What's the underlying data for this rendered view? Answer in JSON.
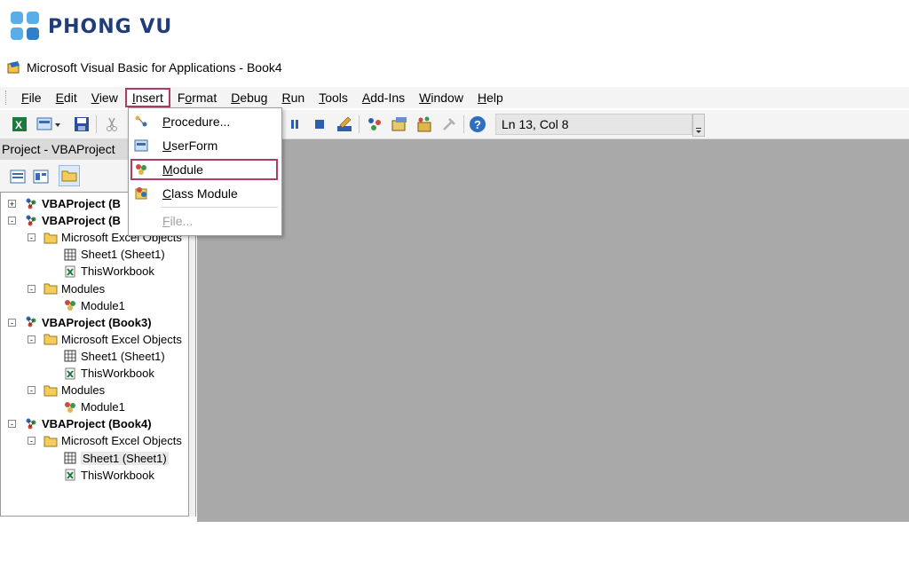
{
  "logo": {
    "text": "PHONG VU",
    "color": "#1f3d7a",
    "accent": "#5aaee8"
  },
  "window": {
    "title": "Microsoft Visual Basic for Applications - Book4",
    "icon": "vba-app-icon"
  },
  "menubar": {
    "items": [
      {
        "id": "file",
        "label": "File",
        "mnemonic": "F"
      },
      {
        "id": "edit",
        "label": "Edit",
        "mnemonic": "E"
      },
      {
        "id": "view",
        "label": "View",
        "mnemonic": "V"
      },
      {
        "id": "insert",
        "label": "Insert",
        "mnemonic": "I",
        "active": true
      },
      {
        "id": "format",
        "label": "Format",
        "mnemonic": "o"
      },
      {
        "id": "debug",
        "label": "Debug",
        "mnemonic": "D"
      },
      {
        "id": "run",
        "label": "Run",
        "mnemonic": "R"
      },
      {
        "id": "tools",
        "label": "Tools",
        "mnemonic": "T"
      },
      {
        "id": "addins",
        "label": "Add-Ins",
        "mnemonic": "A"
      },
      {
        "id": "window",
        "label": "Window",
        "mnemonic": "W"
      },
      {
        "id": "help",
        "label": "Help",
        "mnemonic": "H"
      }
    ]
  },
  "toolbar": {
    "position_text": "Ln 13, Col 8"
  },
  "insert_menu": {
    "items": [
      {
        "label": "Procedure...",
        "icon": "procedure-icon",
        "enabled": true
      },
      {
        "label": "UserForm",
        "icon": "userform-icon",
        "enabled": true
      },
      {
        "label": "Module",
        "icon": "module-icon",
        "enabled": true,
        "highlighted": true
      },
      {
        "label": "Class Module",
        "icon": "class-module-icon",
        "enabled": true
      },
      {
        "label": "File...",
        "icon": "",
        "enabled": false
      }
    ]
  },
  "project": {
    "title": "Project - VBAProject",
    "tree": [
      {
        "label": "VBAProject (B",
        "level": 0,
        "bold": true,
        "icon": "vbaproject-icon",
        "expander": "+"
      },
      {
        "label": "VBAProject (B",
        "level": 0,
        "bold": true,
        "icon": "vbaproject-icon",
        "expander": "-"
      },
      {
        "label": "Microsoft Excel Objects",
        "level": 1,
        "icon": "folder-icon",
        "expander": "-"
      },
      {
        "label": "Sheet1 (Sheet1)",
        "level": 2,
        "icon": "sheet-icon"
      },
      {
        "label": "ThisWorkbook",
        "level": 2,
        "icon": "workbook-icon"
      },
      {
        "label": "Modules",
        "level": 1,
        "icon": "folder-icon",
        "expander": "-"
      },
      {
        "label": "Module1",
        "level": 2,
        "icon": "module-icon"
      },
      {
        "label": "VBAProject (Book3)",
        "level": 0,
        "bold": true,
        "icon": "vbaproject-icon",
        "expander": "-"
      },
      {
        "label": "Microsoft Excel Objects",
        "level": 1,
        "icon": "folder-icon",
        "expander": "-"
      },
      {
        "label": "Sheet1 (Sheet1)",
        "level": 2,
        "icon": "sheet-icon"
      },
      {
        "label": "ThisWorkbook",
        "level": 2,
        "icon": "workbook-icon"
      },
      {
        "label": "Modules",
        "level": 1,
        "icon": "folder-icon",
        "expander": "-"
      },
      {
        "label": "Module1",
        "level": 2,
        "icon": "module-icon"
      },
      {
        "label": "VBAProject (Book4)",
        "level": 0,
        "bold": true,
        "icon": "vbaproject-icon",
        "expander": "-"
      },
      {
        "label": "Microsoft Excel Objects",
        "level": 1,
        "icon": "folder-icon",
        "expander": "-"
      },
      {
        "label": "Sheet1 (Sheet1)",
        "level": 2,
        "icon": "sheet-icon",
        "selected": true
      },
      {
        "label": "ThisWorkbook",
        "level": 2,
        "icon": "workbook-icon"
      }
    ]
  },
  "colors": {
    "highlight_border": "#b03b66",
    "code_bg": "#a9a9a9",
    "chrome_bg": "#f4f4f4"
  }
}
